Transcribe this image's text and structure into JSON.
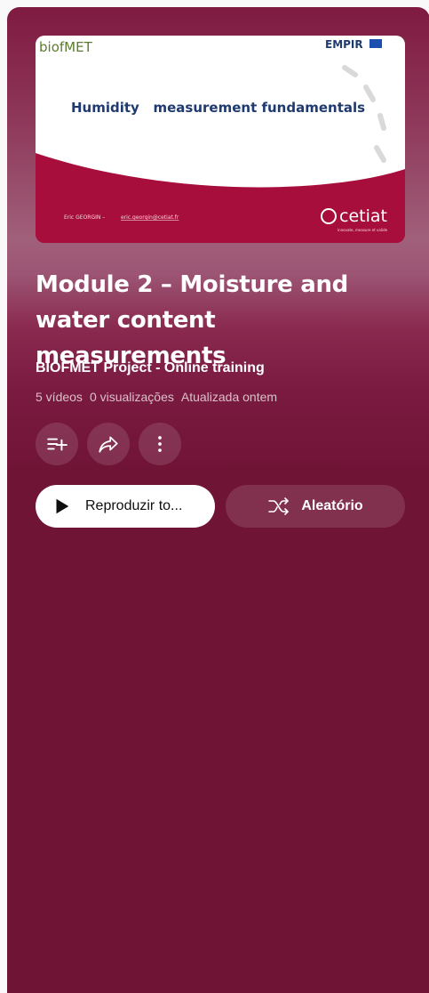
{
  "thumbnail": {
    "logo_left": "biofMET",
    "logo_right": "EMPIR",
    "headline": "Humidity   measurement fundamentals",
    "presenter": "Eric GEORGIN –",
    "presenter_email": "eric.georgin@cetiat.fr",
    "org_logo": "cetiat",
    "org_tagline": "innovate, measure et valide",
    "bg_color": "#a80e3c",
    "headline_color": "#1f3a6e"
  },
  "playlist": {
    "title": "Module 2 – Moisture and water content measurements",
    "owner": "BIOFMET Project - Online training",
    "video_count": "5 vídeos",
    "views": "0 visualizações",
    "updated": "Atualizada ontem"
  },
  "actions": {
    "save_icon": "playlist-add-icon",
    "share_icon": "share-icon",
    "more_icon": "more-vert-icon",
    "play_all_label": "Reproduzir to...",
    "shuffle_label": "Aleatório"
  }
}
